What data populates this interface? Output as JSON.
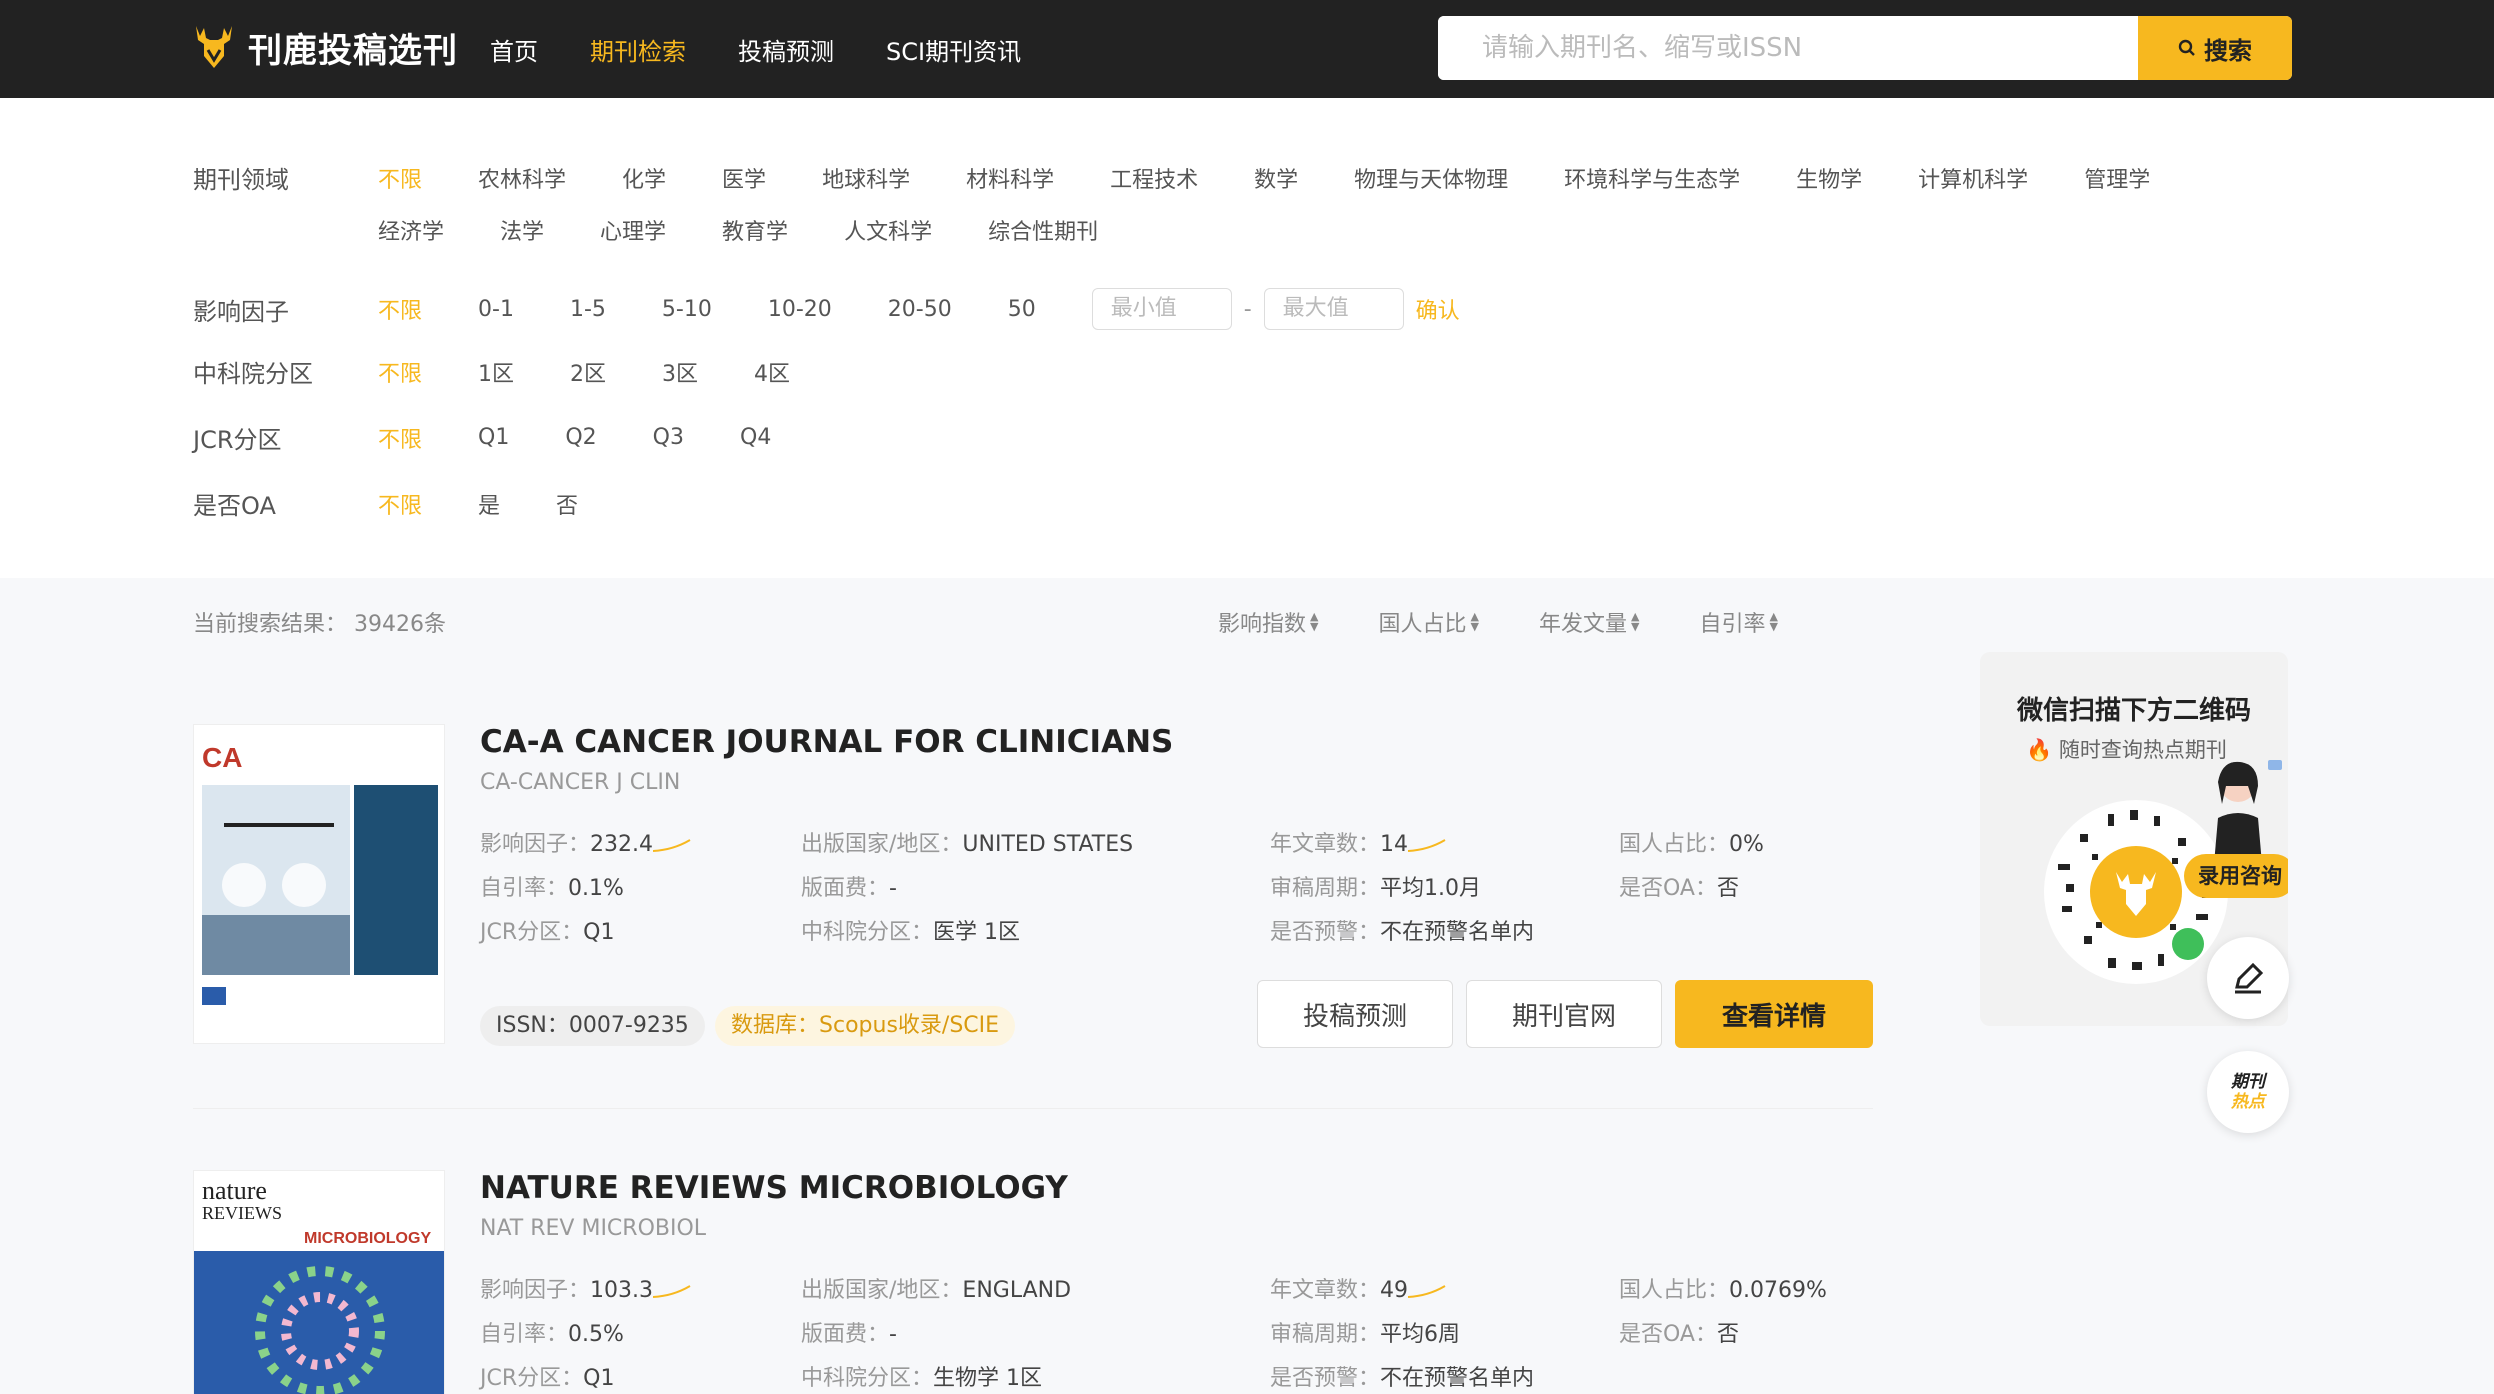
{
  "header": {
    "brand": "刊鹿投稿选刊",
    "nav": [
      "首页",
      "期刊检索",
      "投稿预测",
      "SCI期刊资讯"
    ],
    "nav_active": 1,
    "search_placeholder": "请输入期刊名、缩写或ISSN",
    "search_button": "搜索"
  },
  "filters": {
    "field": {
      "label": "期刊领域",
      "options": [
        "不限",
        "农林科学",
        "化学",
        "医学",
        "地球科学",
        "材料科学",
        "工程技术",
        "数学",
        "物理与天体物理",
        "环境科学与生态学",
        "生物学",
        "计算机科学",
        "管理学"
      ],
      "options_row2": [
        "经济学",
        "法学",
        "心理学",
        "教育学",
        "人文科学",
        "综合性期刊"
      ]
    },
    "impact": {
      "label": "影响因子",
      "options": [
        "不限",
        "0-1",
        "1-5",
        "5-10",
        "10-20",
        "20-50",
        "50"
      ],
      "min_placeholder": "最小值",
      "max_placeholder": "最大值",
      "dash": "-",
      "confirm": "确认"
    },
    "cas": {
      "label": "中科院分区",
      "options": [
        "不限",
        "1区",
        "2区",
        "3区",
        "4区"
      ]
    },
    "jcr": {
      "label": "JCR分区",
      "options": [
        "不限",
        "Q1",
        "Q2",
        "Q3",
        "Q4"
      ]
    },
    "oa": {
      "label": "是否OA",
      "options": [
        "不限",
        "是",
        "否"
      ]
    }
  },
  "results": {
    "count_label": "当前搜索结果：",
    "count_value": "39426条",
    "sorts": [
      "影响指数",
      "国人占比",
      "年发文量",
      "自引率"
    ]
  },
  "labels": {
    "if": "影响因子：",
    "self": "自引率：",
    "jcr": "JCR分区：",
    "country": "出版国家/地区：",
    "fee": "版面费：",
    "cas": "中科院分区：",
    "articles": "年文章数：",
    "review": "审稿周期：",
    "warn": "是否预警：",
    "cn": "国人占比：",
    "oa": "是否OA："
  },
  "journals": [
    {
      "title": "CA-A CANCER JOURNAL FOR CLINICIANS",
      "abbr": "CA-CANCER J CLIN",
      "if": "232.4",
      "self": "0.1%",
      "jcr": "Q1",
      "country": "UNITED STATES",
      "fee": "-",
      "cas": "医学 1区",
      "articles": "14",
      "review": "平均1.0月",
      "warn": "不在预警名单内",
      "cn": "0%",
      "oa": "否",
      "issn_label": "ISSN：",
      "issn": "0007-9235",
      "db_label": "数据库：",
      "db": "Scopus收录/SCIE",
      "btn_predict": "投稿预测",
      "btn_site": "期刊官网",
      "btn_detail": "查看详情",
      "cover_text": "CA"
    },
    {
      "title": "NATURE REVIEWS MICROBIOLOGY",
      "abbr": "NAT REV MICROBIOL",
      "if": "103.3",
      "self": "0.5%",
      "jcr": "Q1",
      "country": "ENGLAND",
      "fee": "-",
      "cas": "生物学 1区",
      "articles": "49",
      "review": "平均6周",
      "warn": "不在预警名单内",
      "cn": "0.0769%",
      "oa": "否",
      "cover_text_1": "nature",
      "cover_text_2": "REVIEWS",
      "cover_text_3": "MICROBIOLOGY"
    }
  ],
  "side": {
    "title": "微信扫描下方二维码",
    "subtitle": "随时查询热点期刊",
    "badge": "录用咨询",
    "hot_1": "期刊",
    "hot_2": "热点"
  },
  "colors": {
    "accent": "#f7b81f",
    "header_bg": "#222222"
  }
}
